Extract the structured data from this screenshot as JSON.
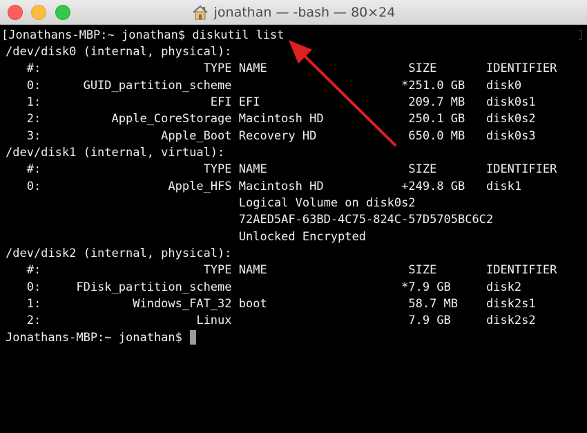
{
  "window": {
    "title": "jonathan — -bash — 80×24",
    "colors": {
      "close": "#fc605c",
      "minimize": "#fdbc40",
      "maximize": "#34c84a",
      "annotation_arrow": "#e02020"
    },
    "title_icon": "home-icon"
  },
  "terminal": {
    "lines": [
      "[Jonathans-MBP:~ jonathan$ diskutil list",
      "/dev/disk0 (internal, physical):",
      "   #:                       TYPE NAME                    SIZE       IDENTIFIER",
      "   0:      GUID_partition_scheme                        *251.0 GB   disk0",
      "   1:                        EFI EFI                     209.7 MB   disk0s1",
      "   2:          Apple_CoreStorage Macintosh HD            250.1 GB   disk0s2",
      "   3:                 Apple_Boot Recovery HD             650.0 MB   disk0s3",
      "/dev/disk1 (internal, virtual):",
      "   #:                       TYPE NAME                    SIZE       IDENTIFIER",
      "   0:                  Apple_HFS Macintosh HD           +249.8 GB   disk1",
      "                                 Logical Volume on disk0s2",
      "                                 72AED5AF-63BD-4C75-824C-57D5705BC6C2",
      "                                 Unlocked Encrypted",
      "/dev/disk2 (internal, physical):",
      "   #:                       TYPE NAME                    SIZE       IDENTIFIER",
      "   0:     FDisk_partition_scheme                        *7.9 GB     disk2",
      "   1:             Windows_FAT_32 boot                    58.7 MB    disk2s1",
      "   2:                      Linux                         7.9 GB     disk2s2"
    ],
    "prompt": "Jonathans-MBP:~ jonathan$ "
  }
}
